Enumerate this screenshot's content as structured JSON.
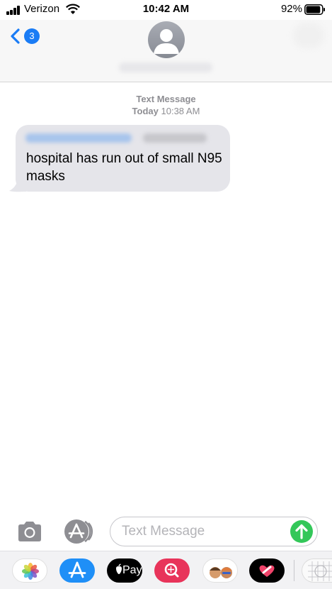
{
  "status_bar": {
    "carrier": "Verizon",
    "time": "10:42 AM",
    "battery_percent": "92%",
    "battery_level": 0.92
  },
  "header": {
    "back_badge_count": "3"
  },
  "conversation": {
    "service_label": "Text Message",
    "date_label": "Today",
    "time_label": "10:38 AM",
    "messages": [
      {
        "direction": "incoming",
        "text": "hospital has run out of small N95 masks"
      }
    ]
  },
  "composer": {
    "placeholder": "Text Message"
  },
  "app_drawer": {
    "apps": [
      {
        "icon": "photos-icon"
      },
      {
        "icon": "app-store-icon"
      },
      {
        "icon": "apple-pay-icon",
        "label": "Pay"
      },
      {
        "icon": "web-search-icon"
      },
      {
        "icon": "memoji-icon"
      },
      {
        "icon": "digital-touch-icon"
      },
      {
        "icon": "more-apps-icon"
      }
    ]
  },
  "colors": {
    "accent": "#1a7cf5",
    "send": "#33c759",
    "bubble_incoming": "#e5e5ea",
    "secondary_text": "#8e8e93"
  }
}
